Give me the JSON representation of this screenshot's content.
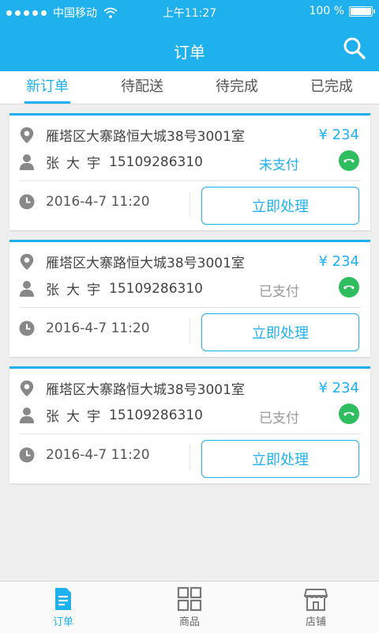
{
  "status_bar": {
    "carrier": "中国移动",
    "time": "上午11:27",
    "battery": "100 %"
  },
  "header": {
    "title": "订单"
  },
  "tabs": [
    {
      "label": "新订单",
      "active": true
    },
    {
      "label": "待配送",
      "active": false
    },
    {
      "label": "待完成",
      "active": false
    },
    {
      "label": "已完成",
      "active": false
    }
  ],
  "orders": [
    {
      "address": "雁塔区大寨路恒大城38号3001室",
      "price": "¥ 234",
      "name": "张大宇",
      "phone": "15109286310",
      "pay_status": "未支付",
      "datetime": "2016-4-7  11:20",
      "action_label": "立即处理"
    },
    {
      "address": "雁塔区大寨路恒大城38号3001室",
      "price": "¥ 234",
      "name": "张大宇",
      "phone": "15109286310",
      "pay_status": "已支付",
      "datetime": "2016-4-7  11:20",
      "action_label": "立即处理"
    },
    {
      "address": "雁塔区大寨路恒大城38号3001室",
      "price": "¥ 234",
      "name": "张大宇",
      "phone": "15109286310",
      "pay_status": "已支付",
      "datetime": "2016-4-7  11:20",
      "action_label": "立即处理"
    }
  ],
  "bottom_nav": [
    {
      "label": "订单",
      "icon": "document-icon",
      "active": true
    },
    {
      "label": "商品",
      "icon": "grid-icon",
      "active": false
    },
    {
      "label": "店铺",
      "icon": "store-icon",
      "active": false
    }
  ],
  "colors": {
    "accent": "#1fb0ee",
    "call_green": "#2ebd5f",
    "background": "#efefef"
  }
}
